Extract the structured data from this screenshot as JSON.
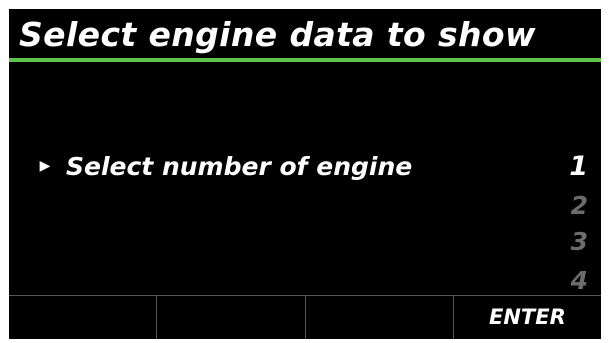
{
  "screen": {
    "title": "Select engine data to show",
    "accent_color": "#5fc34a",
    "background_color": "#000000"
  },
  "menu": {
    "selected_item_icon": "right-triangle-icon",
    "item_label": "Select number of engine",
    "options": [
      {
        "label": "1",
        "selected": true
      },
      {
        "label": "2",
        "selected": false
      },
      {
        "label": "3",
        "selected": false
      },
      {
        "label": "4",
        "selected": false
      }
    ]
  },
  "softkeys": [
    {
      "label": ""
    },
    {
      "label": ""
    },
    {
      "label": ""
    },
    {
      "label": "ENTER"
    }
  ]
}
